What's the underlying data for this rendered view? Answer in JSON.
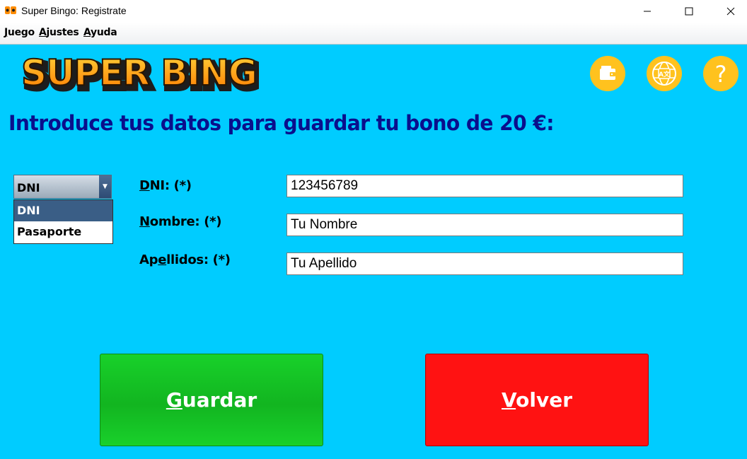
{
  "window": {
    "title": "Super Bingo: Registrate",
    "app_icon": "bingo-app-icon",
    "controls": [
      "minimize-icon",
      "maximize-icon",
      "close-icon"
    ]
  },
  "menu": {
    "items": [
      "Juego",
      "Ajustes",
      "Ayuda"
    ]
  },
  "header": {
    "logo_text": "SUPER BINGO",
    "buttons": [
      {
        "icon": "wallet-icon"
      },
      {
        "icon": "language-globe-icon"
      },
      {
        "icon": "help-icon",
        "label": "?"
      }
    ]
  },
  "form": {
    "heading": "Introduce tus datos para guardar tu bono de 20 €:",
    "doc_type": {
      "selected": "DNI",
      "options": [
        "DNI",
        "Pasaporte"
      ],
      "highlighted": "DNI"
    },
    "fields": [
      {
        "label": "DNI: (*)",
        "value": "123456789"
      },
      {
        "label": "Nombre: (*)",
        "value": "Tu Nombre"
      },
      {
        "label": "Apellidos: (*)",
        "value": "Tu Apellido"
      }
    ]
  },
  "actions": {
    "save_label": "Guardar",
    "back_label": "Volver"
  },
  "colors": {
    "background": "#00ccff",
    "heading": "#0a0f8c",
    "save": "#12b520",
    "back": "#ff1212",
    "icon_button": "#ffc21e"
  }
}
